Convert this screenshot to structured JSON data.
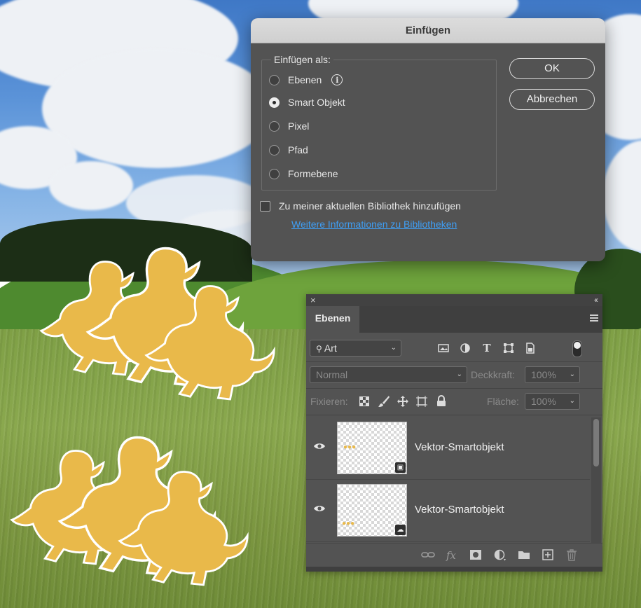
{
  "dialog": {
    "title": "Einfügen",
    "group_label": "Einfügen als:",
    "options": [
      {
        "label": "Ebenen",
        "checked": false
      },
      {
        "label": "Smart Objekt",
        "checked": true
      },
      {
        "label": "Pixel",
        "checked": false
      },
      {
        "label": "Pfad",
        "checked": false
      },
      {
        "label": "Formebene",
        "checked": false
      }
    ],
    "info_icon": "info-icon",
    "ok_label": "OK",
    "cancel_label": "Abbrechen",
    "library_checkbox_label": "Zu meiner aktuellen Bibliothek hinzufügen",
    "library_checked": false,
    "library_link": "Weitere Informationen zu Bibliotheken"
  },
  "layers_panel": {
    "close_glyph": "×",
    "collapse_glyph": "‹‹",
    "tab_label": "Ebenen",
    "filter_kind": "Art",
    "filter_icons": [
      "image-filter-icon",
      "adjustment-filter-icon",
      "type-filter-icon",
      "shape-filter-icon",
      "smartobject-filter-icon"
    ],
    "blend_mode": "Normal",
    "opacity_label": "Deckkraft:",
    "opacity_value": "100%",
    "lock_label": "Fixieren:",
    "fill_label": "Fläche:",
    "fill_value": "100%",
    "layers": [
      {
        "name": "Vektor-Smartobjekt",
        "visible": true,
        "badge": "smart-object-icon"
      },
      {
        "name": "Vektor-Smartobjekt",
        "visible": true,
        "badge": "cloud-smart-object-icon"
      }
    ],
    "bottom_icons": [
      "link-layers-icon",
      "fx-icon",
      "mask-icon",
      "adjustment-layer-icon",
      "group-folder-icon",
      "new-layer-icon",
      "delete-icon"
    ],
    "fx_label": "fx"
  },
  "colors": {
    "dialog_bg": "#535353",
    "accent_link": "#3f9ef4",
    "duck_fill": "#e9b94a"
  }
}
